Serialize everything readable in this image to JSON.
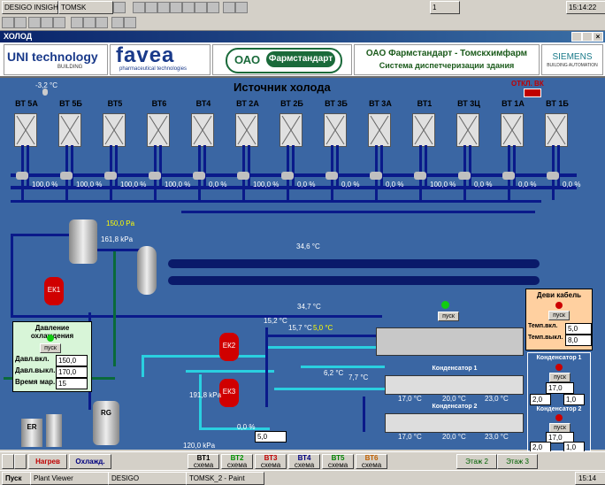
{
  "topbar": {
    "app_title": "DESIGO INSIGHT",
    "project": "TOMSK",
    "window_count": "1",
    "clock": "15:14:22"
  },
  "window": {
    "title": "ХОЛОД"
  },
  "logos": {
    "unitechnology": "UNI technology",
    "unitechnology_sub": "BUILDING",
    "favea": "favea",
    "favea_sub": "pharmaceutical technologies",
    "ooo_left": "ОАО",
    "ooo_right": "Фармстандарт",
    "company_line1": "ОАО  Фармстандарт - Томскхимфарм",
    "company_line2": "Система диспетчеризации здания",
    "siemens": "SIEMENS",
    "siemens_sub": "BUILDING AUTOMATION"
  },
  "scheme": {
    "title": "Источник холода",
    "outdoor_temp": "-3,2 °C",
    "alarm_label": "ОТКЛ. ВК",
    "units": [
      {
        "label": "ВТ 5А",
        "valve": "100,0 %"
      },
      {
        "label": "ВТ 5Б",
        "valve": "100,0 %"
      },
      {
        "label": "ВТ5",
        "valve": "100,0 %"
      },
      {
        "label": "ВТ6",
        "valve": "100,0 %"
      },
      {
        "label": "ВТ4",
        "valve": "0,0 %"
      },
      {
        "label": "ВТ 2А",
        "valve": "100,0 %"
      },
      {
        "label": "ВТ 2Б",
        "valve": "0,0 %"
      },
      {
        "label": "ВТ 3Б",
        "valve": "0,0 %"
      },
      {
        "label": "ВТ 3А",
        "valve": "0,0 %"
      },
      {
        "label": "ВТ1",
        "valve": "100,0 %"
      },
      {
        "label": "ВТ 3Ц",
        "valve": "0,0 %"
      },
      {
        "label": "ВТ 1А",
        "valve": "0,0 %"
      },
      {
        "label": "ВТ 1Б",
        "valve": "0,0 %"
      }
    ],
    "pressure_top": "150,0 Pa",
    "pressure_tank": "161,8 kPa",
    "temp_header": "34,6 °C",
    "temp_return": "34,7 °C",
    "tank_ek1": "ЕК1",
    "tank_ek2": "ЕК2",
    "tank_ek3": "ЕК3",
    "tank_rg": "RG",
    "tank_er": "ER",
    "temp_152": "15,2 °C",
    "temp_157": "15,7 °C",
    "temp_50": "5,0 °C",
    "temp_62": "6,2 °C",
    "temp_77": "7,7 °C",
    "pressure_191": "191,8 kPa",
    "pressure_120": "120,0 kPa",
    "valve_0": "0,0 %",
    "setpoint_50": "5,0",
    "start_label": "пуск"
  },
  "cooling_panel": {
    "title": "Давление охлаждения",
    "start": "пуск",
    "rows": [
      {
        "label": "Давл.вкл.",
        "value": "150,0"
      },
      {
        "label": "Давл.выкл.",
        "value": "170,0"
      },
      {
        "label": "Время мар.",
        "value": "15"
      }
    ]
  },
  "cable_panel": {
    "title": "Деви кабель",
    "start": "пуск",
    "rows": [
      {
        "label": "Темп.вкл.",
        "value": "5,0"
      },
      {
        "label": "Темп.выкл.",
        "value": "8,0"
      }
    ]
  },
  "condenser_panel": {
    "cond1": "Конденсатор 1",
    "cond2": "Конденсатор 2",
    "start": "пуск",
    "c1_set": "17,0",
    "c1_a": "2,0",
    "c1_b": "1,0",
    "c2_set": "17,0",
    "c2_a": "2,0",
    "c2_b": "1,0"
  },
  "condensers": {
    "label1": "Конденсатор 1",
    "label2": "Конденсатор 2",
    "row1": [
      "17,0 °C",
      "20,0 °C",
      "23,0 °C"
    ],
    "row2": [
      "17,0 °C",
      "20,0 °C",
      "23,0 °C"
    ]
  },
  "bottom_nav": {
    "heat": "Нагрев",
    "cool": "Охлажд.",
    "schemes": [
      {
        "top": "ВТ1",
        "bottom": "схема",
        "color": "#000000"
      },
      {
        "top": "ВТ2",
        "bottom": "схема",
        "color": "#009000"
      },
      {
        "top": "ВТ3",
        "bottom": "схема",
        "color": "#c00000"
      },
      {
        "top": "ВТ4",
        "bottom": "схема",
        "color": "#000080"
      },
      {
        "top": "ВТ5",
        "bottom": "схема",
        "color": "#008000"
      },
      {
        "top": "ВТ6",
        "bottom": "схема",
        "color": "#c06000"
      }
    ],
    "floor2": "Этаж 2",
    "floor3": "Этаж 3"
  },
  "taskbar": {
    "start": "Пуск",
    "tasks": [
      "Plant Viewer",
      "DESIGO",
      "TOMSK_2 - Paint"
    ],
    "time": "15:14"
  }
}
